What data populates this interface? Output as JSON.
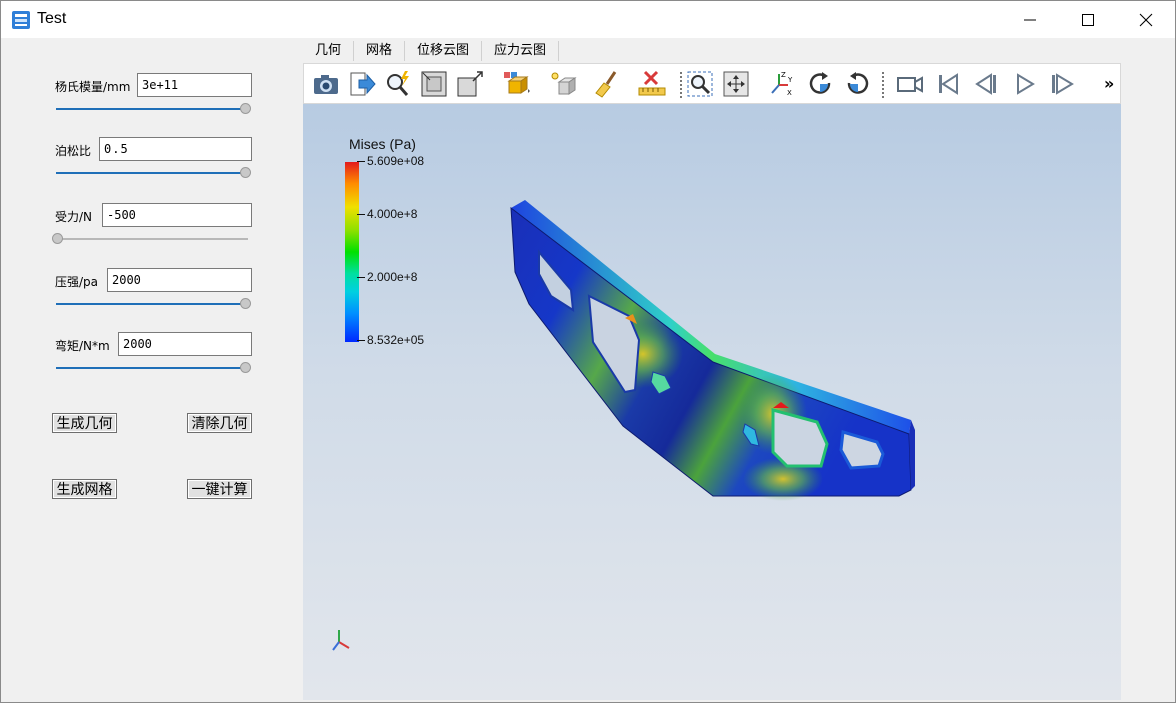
{
  "window": {
    "title": "Test",
    "controls": {
      "minimize": "minimize-icon",
      "maximize": "maximize-icon",
      "close": "close-icon"
    }
  },
  "params": [
    {
      "id": "youngs_modulus",
      "label": "杨氏模量/mm",
      "value": "3e+11",
      "slider_level": 1.0
    },
    {
      "id": "poisson_ratio",
      "label": "泊松比",
      "value": "0.5",
      "slider_level": 1.0
    },
    {
      "id": "force",
      "label": "受力/N",
      "value": "-500",
      "slider_level": 0.0
    },
    {
      "id": "pressure",
      "label": "压强/pa",
      "value": "2000",
      "slider_level": 1.0
    },
    {
      "id": "moment",
      "label": "弯矩/N*m",
      "value": "2000",
      "slider_level": 1.0
    }
  ],
  "buttons": {
    "generate_geometry": "生成几何",
    "clear_geometry": "清除几何",
    "generate_mesh": "生成网格",
    "one_click_compute": "一键计算"
  },
  "tabs": [
    "几何",
    "网格",
    "位移云图",
    "应力云图"
  ],
  "toolbar": [
    "camera-icon",
    "export-icon",
    "zoom-pick-icon",
    "fit-view-icon",
    "zoom-box-icon",
    "view-cube-icon",
    "light-icon",
    "brush-icon",
    "measure-ruler-icon",
    "zoom-window-icon",
    "pan-icon",
    "axes-xyz-icon",
    "rotate-cw-icon",
    "rotate-ccw-icon",
    "video-camera-icon",
    "first-frame-icon",
    "prev-frame-icon",
    "play-icon",
    "next-frame-icon"
  ],
  "toolbar_more": "»",
  "legend": {
    "title": "Mises (Pa)",
    "max": "5.609e+08",
    "t1": "4.000e+8",
    "t2": "2.000e+8",
    "min": "8.532e+05"
  },
  "colors": {
    "slider_track_active": "#1f6fb8",
    "slider_track_inactive": "#b8b8b8",
    "stress_high": "#e31a1c",
    "stress_low": "#0028ff"
  }
}
